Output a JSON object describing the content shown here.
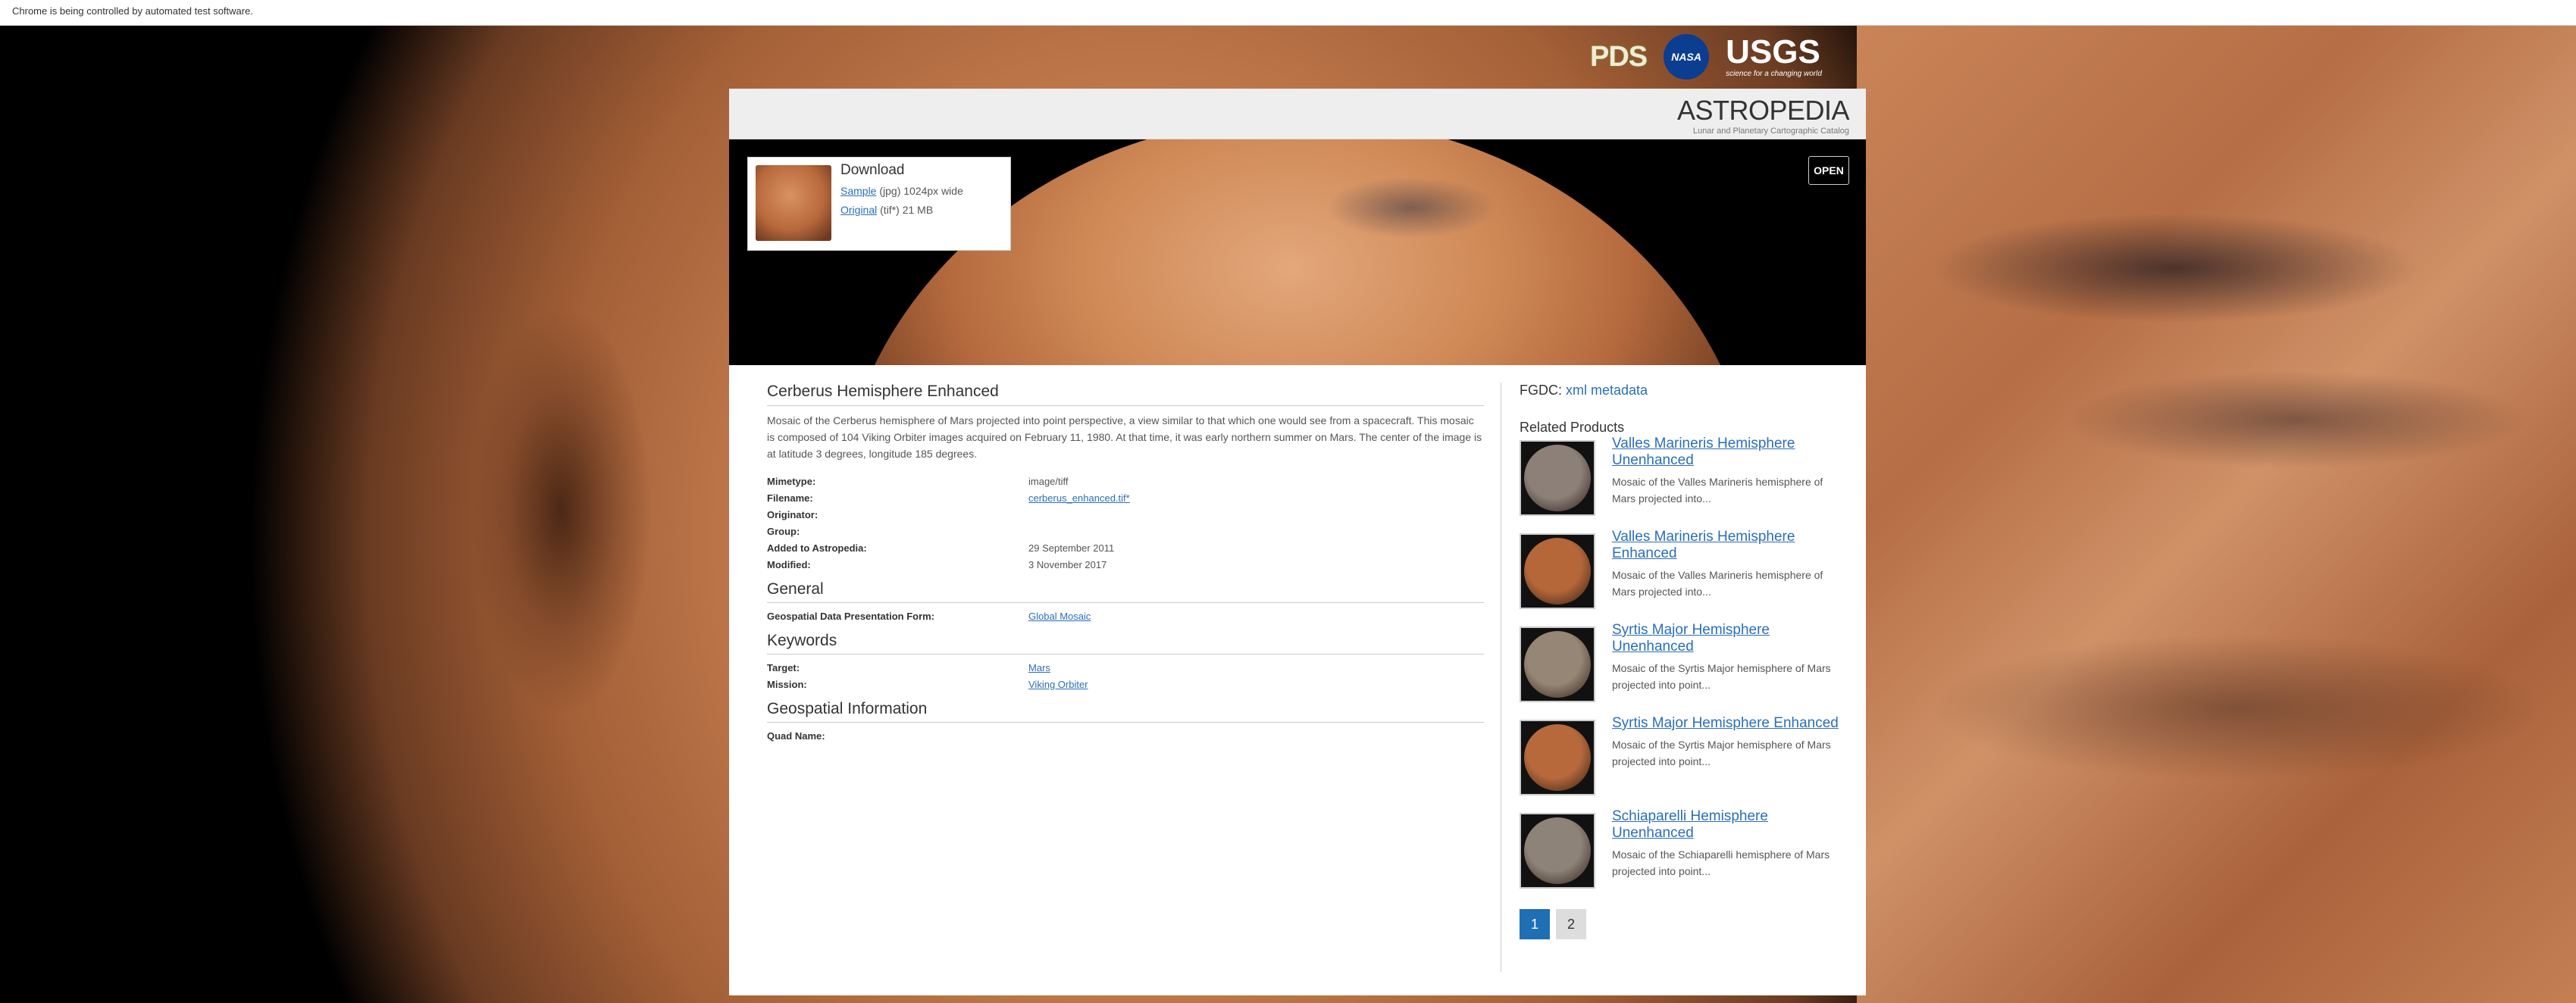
{
  "browser": {
    "automation_notice": "Chrome is being controlled by automated test software."
  },
  "header": {
    "pds_label": "PDS",
    "nasa_label": "NASA",
    "usgs_label": "USGS",
    "usgs_tagline": "science for a changing world"
  },
  "site": {
    "title": "ASTROPEDIA",
    "subtitle": "Lunar and Planetary Cartographic Catalog"
  },
  "download": {
    "title": "Download",
    "sample_link": "Sample",
    "sample_text": "(jpg) 1024px wide",
    "original_link": "Original",
    "original_text": "(tif*) 21 MB"
  },
  "open_button": "OPEN",
  "product": {
    "title": "Cerberus Hemisphere Enhanced",
    "description": "Mosaic of the Cerberus hemisphere of Mars projected into point perspective, a view similar to that which one would see from a spacecraft. This mosaic is composed of 104 Viking Orbiter images acquired on February 11, 1980. At that time, it was early northern summer on Mars. The center of the image is at latitude 3 degrees, longitude 185 degrees.",
    "meta": [
      {
        "key": "Mimetype:",
        "value": "image/tiff"
      },
      {
        "key": "Filename:",
        "value": "cerberus_enhanced.tif*"
      },
      {
        "key": "Originator:",
        "value": ""
      },
      {
        "key": "Group:",
        "value": ""
      },
      {
        "key": "Added to Astropedia:",
        "value": "29 September 2011"
      },
      {
        "key": "Modified:",
        "value": "3 November 2017"
      }
    ],
    "general": {
      "heading": "General",
      "key": "Geospatial Data Presentation Form:",
      "value": "Global Mosaic"
    },
    "keywords": {
      "heading": "Keywords",
      "target_key": "Target:",
      "target_value": "Mars",
      "mission_key": "Mission:",
      "mission_value": "Viking Orbiter"
    },
    "geo": {
      "heading": "Geospatial Information",
      "key": "Quad Name:",
      "value": ""
    }
  },
  "sidebar": {
    "fgdc_label": "FGDC:",
    "fgdc_link": "xml metadata",
    "related_heading": "Related Products",
    "related": [
      {
        "title": "Valles Marineris Hemisphere Unenhanced",
        "desc": "Mosaic of the Valles Marineris hemisphere of Mars projected into...",
        "color": "#8c8078"
      },
      {
        "title": "Valles Marineris Hemisphere Enhanced",
        "desc": "Mosaic of the Valles Marineris hemisphere of Mars projected into...",
        "color": "#b5673a"
      },
      {
        "title": "Syrtis Major Hemisphere Unenhanced",
        "desc": "Mosaic of the Syrtis Major hemisphere of Mars projected into point...",
        "color": "#958675"
      },
      {
        "title": "Syrtis Major Hemisphere Enhanced",
        "desc": "Mosaic of the Syrtis Major hemisphere of Mars projected into point...",
        "color": "#b8693c"
      },
      {
        "title": "Schiaparelli Hemisphere Unenhanced",
        "desc": "Mosaic of the Schiaparelli hemisphere of Mars projected into point...",
        "color": "#8e8378"
      }
    ],
    "pages": [
      "1",
      "2"
    ],
    "current_page": "1"
  }
}
